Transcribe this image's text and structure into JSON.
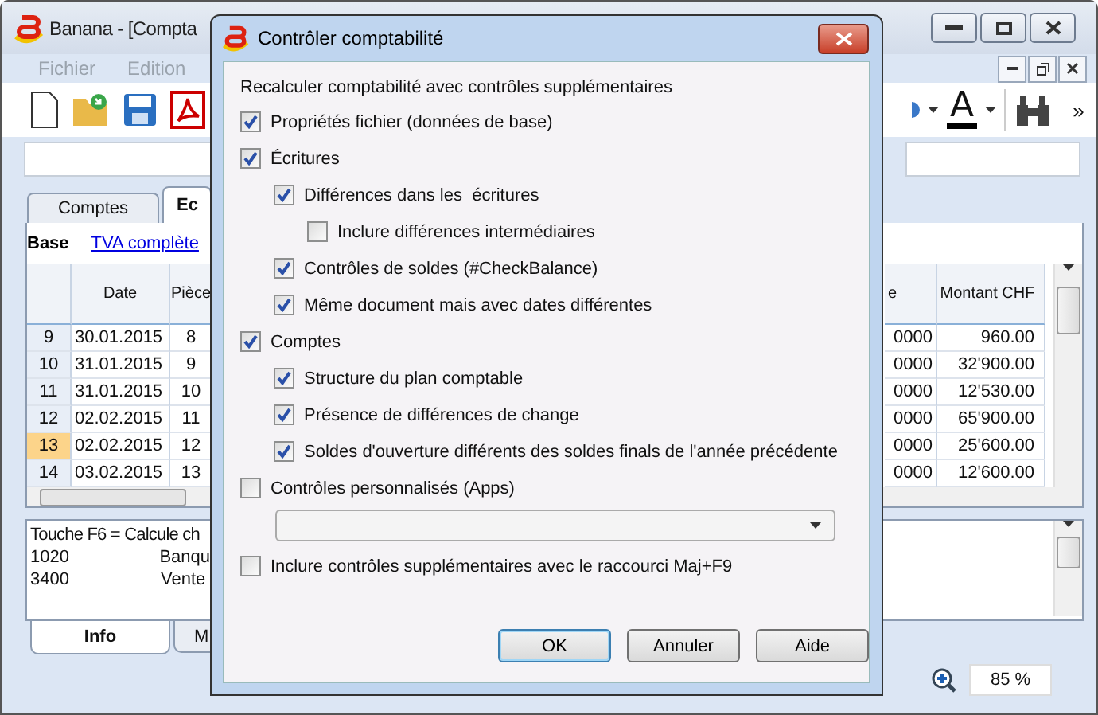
{
  "main_window": {
    "title": "Banana - [Compta",
    "menu": [
      "Fichier",
      "Edition"
    ],
    "toolbar": {
      "font_color_glyph": "A",
      "overflow": "»"
    },
    "tabs": [
      {
        "label": "Comptes",
        "selected": false
      },
      {
        "label": "Ec",
        "selected": true
      }
    ],
    "views": [
      {
        "label": "Base",
        "selected": true
      },
      {
        "label": "TVA complète",
        "selected": false
      }
    ],
    "table": {
      "columns": [
        "Date",
        "Pièce",
        "e",
        "Montant CHF"
      ],
      "rows": [
        {
          "num": "9",
          "date": "30.01.2015",
          "doc": "8",
          "column_4": "0000",
          "amount": "960.00",
          "selected": false
        },
        {
          "num": "10",
          "date": "31.01.2015",
          "doc": "9",
          "column_4": "0000",
          "amount": "32'900.00",
          "selected": false
        },
        {
          "num": "11",
          "date": "31.01.2015",
          "doc": "10",
          "column_4": "0000",
          "amount": "12'530.00",
          "selected": false
        },
        {
          "num": "12",
          "date": "02.02.2015",
          "doc": "11",
          "column_4": "0000",
          "amount": "65'900.00",
          "selected": false
        },
        {
          "num": "13",
          "date": "02.02.2015",
          "doc": "12",
          "column_4": "0000",
          "amount": "25'600.00",
          "selected": true
        },
        {
          "num": "14",
          "date": "03.02.2015",
          "doc": "13",
          "column_4": "0000",
          "amount": "12'600.00",
          "selected": false
        }
      ]
    },
    "info": {
      "message": "Touche F6 = Calcule ch",
      "lines": [
        {
          "account": "1020",
          "text": "Banqu"
        },
        {
          "account": "3400",
          "text": "Vente"
        }
      ]
    },
    "info_tabs": [
      {
        "label": "Info",
        "selected": true
      },
      {
        "label": "M",
        "selected": false
      }
    ],
    "zoom": "85 %"
  },
  "dialog": {
    "title": "Contrôler comptabilité",
    "heading": "Recalculer comptabilité avec contrôles supplémentaires",
    "items": [
      {
        "kind": "check",
        "label": "Propriétés fichier (données de base)",
        "checked": true
      },
      {
        "kind": "check",
        "label": "Écritures",
        "checked": true,
        "children": [
          {
            "kind": "check",
            "label": "Différences dans les  écritures",
            "checked": true,
            "children": [
              {
                "kind": "check",
                "label": "Inclure différences intermédiaires",
                "checked": false
              }
            ]
          },
          {
            "kind": "check",
            "label": "Contrôles de soldes (#CheckBalance)",
            "checked": true
          },
          {
            "kind": "check",
            "label": "Même document mais avec dates différentes",
            "checked": true
          }
        ]
      },
      {
        "kind": "check",
        "label": "Comptes",
        "checked": true,
        "children": [
          {
            "kind": "check",
            "label": "Structure du plan comptable",
            "checked": true
          },
          {
            "kind": "check",
            "label": "Présence de différences de change",
            "checked": true
          },
          {
            "kind": "check",
            "label": "Soldes d'ouverture différents des soldes finals de l'année précédente",
            "checked": true
          }
        ]
      },
      {
        "kind": "check",
        "label": "Contrôles personnalisés (Apps)",
        "checked": false
      },
      {
        "kind": "dropdown"
      },
      {
        "kind": "check",
        "label": "Inclure contrôles supplémentaires avec le raccourci Maj+F9",
        "checked": false
      }
    ],
    "buttons": [
      {
        "label": "OK",
        "default": true
      },
      {
        "label": "Annuler",
        "default": false
      },
      {
        "label": "Aide",
        "default": false
      }
    ]
  }
}
